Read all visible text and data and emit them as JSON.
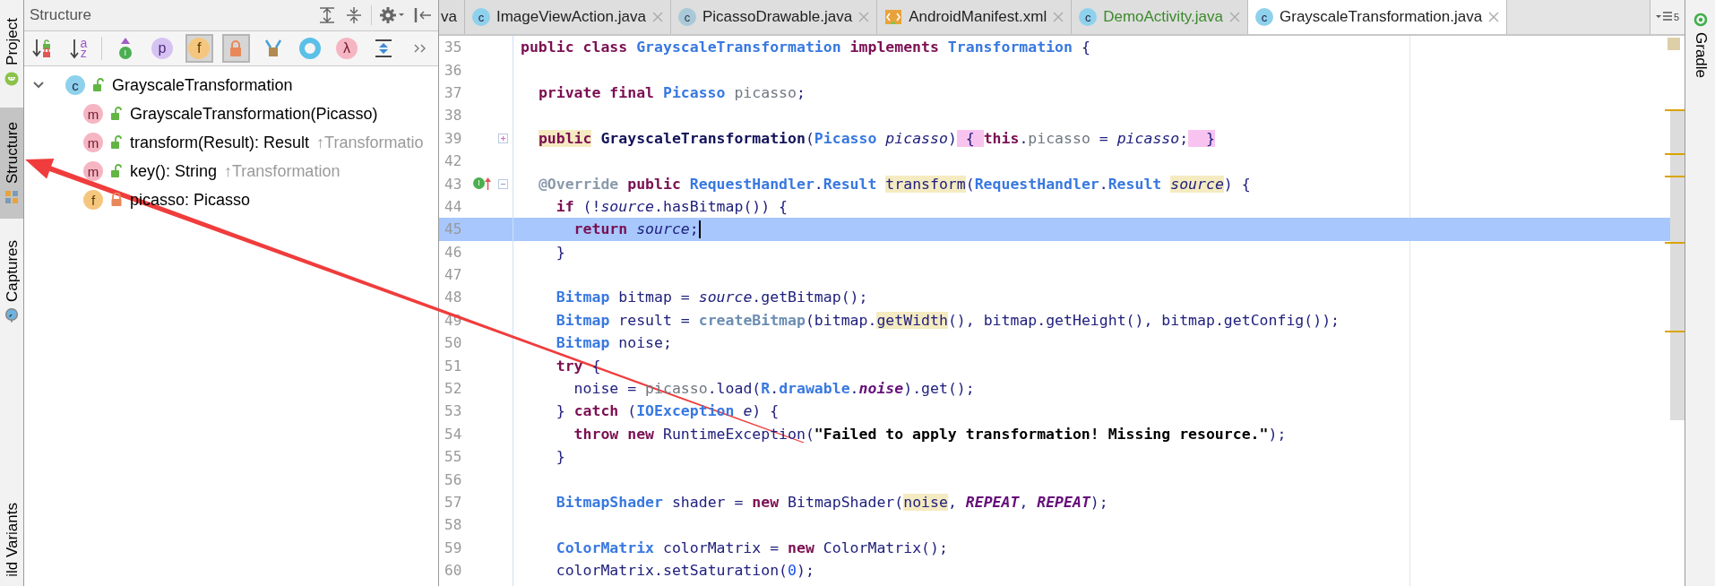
{
  "left_stripe": [
    {
      "label": "Project",
      "selected": false
    },
    {
      "label": "Structure",
      "selected": true
    },
    {
      "label": "Captures",
      "selected": false
    },
    {
      "label": "ild Variants",
      "selected": false
    }
  ],
  "structure_panel": {
    "title": "Structure",
    "toolbar": [
      {
        "kind": "sort-visibility",
        "selected": false
      },
      {
        "kind": "sort-alpha",
        "glyph": "az",
        "selected": false
      },
      {
        "kind": "inherited",
        "glyph": "I",
        "selected": false
      },
      {
        "kind": "properties",
        "glyph": "p",
        "selected": false
      },
      {
        "kind": "fields",
        "glyph": "f",
        "selected": true
      },
      {
        "kind": "non-public",
        "selected": true
      },
      {
        "kind": "anonymous",
        "selected": false
      },
      {
        "kind": "ring",
        "selected": false
      },
      {
        "kind": "lambdas",
        "glyph": "λ",
        "selected": false
      },
      {
        "kind": "autoscroll",
        "selected": false
      },
      {
        "kind": "more",
        "selected": false
      }
    ],
    "tree": {
      "kind": "class",
      "badge": "c",
      "private": false,
      "label": "GrayscaleTransformation",
      "expanded": true,
      "children": [
        {
          "kind": "method",
          "badge": "m",
          "private": false,
          "label": "GrayscaleTransformation(Picasso)"
        },
        {
          "kind": "method",
          "badge": "m",
          "private": false,
          "label": "transform(Result): Result",
          "inherited": "↑Transformatio"
        },
        {
          "kind": "method",
          "badge": "m",
          "private": false,
          "label": "key(): String",
          "inherited": "↑Transformation"
        },
        {
          "kind": "field",
          "badge": "f",
          "private": true,
          "label": "picasso: Picasso"
        }
      ]
    }
  },
  "editor": {
    "tabs": [
      {
        "kind": "partial",
        "label": "va",
        "selected": false,
        "added": false
      },
      {
        "kind": "class",
        "label": "ImageViewAction.java",
        "badge": "c",
        "selected": false,
        "added": false
      },
      {
        "kind": "drawable",
        "label": "PicassoDrawable.java",
        "badge": "c",
        "selected": false,
        "added": false
      },
      {
        "kind": "manifest",
        "label": "AndroidManifest.xml",
        "selected": false,
        "added": false
      },
      {
        "kind": "class",
        "label": "DemoActivity.java",
        "badge": "c",
        "selected": false,
        "added": true
      },
      {
        "kind": "class",
        "label": "GrayscaleTransformation.java",
        "badge": "c",
        "selected": true,
        "added": false
      }
    ],
    "hidden_tabs_count": "5",
    "lines": [
      {
        "number": "35",
        "current": false,
        "tokens": [
          {
            "kind": "kw",
            "text": "public class "
          },
          {
            "kind": "type",
            "text": "GrayscaleTransformation"
          },
          {
            "kind": "kw",
            "text": " implements "
          },
          {
            "kind": "type",
            "text": "Transformation"
          },
          {
            "kind": "plain",
            "text": " {"
          }
        ]
      },
      {
        "number": "36",
        "current": false
      },
      {
        "number": "37",
        "current": false,
        "tokens": [
          {
            "kind": "kw",
            "text": "  private final "
          },
          {
            "kind": "type",
            "text": "Picasso"
          },
          {
            "kind": "field",
            "text": " picasso"
          },
          {
            "kind": "plain",
            "text": ";"
          }
        ]
      },
      {
        "number": "38",
        "current": false
      },
      {
        "number": "39",
        "current": false,
        "folded": true,
        "tokens": [
          {
            "kind": "kw",
            "text": "  public",
            "usage_highlight": true
          },
          {
            "kind": "decl",
            "text": " GrayscaleTransformation"
          },
          {
            "kind": "plain",
            "text": "("
          },
          {
            "kind": "type",
            "text": "Picasso"
          },
          {
            "kind": "param",
            "text": " picasso"
          },
          {
            "kind": "plain",
            "text": ")"
          },
          {
            "kind": "plain",
            "text": " { ",
            "brace_highlight": true
          },
          {
            "kind": "kw",
            "text": "this"
          },
          {
            "kind": "plain",
            "text": "."
          },
          {
            "kind": "field",
            "text": "picasso"
          },
          {
            "kind": "plain",
            "text": " = "
          },
          {
            "kind": "param",
            "text": "picasso"
          },
          {
            "kind": "plain",
            "text": ";"
          },
          {
            "kind": "plain",
            "text": "  }",
            "brace_highlight": true
          }
        ]
      },
      {
        "number": "42",
        "current": false
      },
      {
        "number": "43",
        "current": false,
        "folded": false,
        "implements": true,
        "gutter_glyph": "I",
        "tokens": [
          {
            "kind": "annotation",
            "text": "  @Override"
          },
          {
            "kind": "kw",
            "text": " public "
          },
          {
            "kind": "type",
            "text": "RequestHandler"
          },
          {
            "kind": "plain",
            "text": "."
          },
          {
            "kind": "type",
            "text": "Result"
          },
          {
            "kind": "plain",
            "text": " transform",
            "usage_highlight": true
          },
          {
            "kind": "plain",
            "text": "("
          },
          {
            "kind": "type",
            "text": "RequestHandler"
          },
          {
            "kind": "plain",
            "text": "."
          },
          {
            "kind": "type",
            "text": "Result"
          },
          {
            "kind": "param",
            "text": " source",
            "usage_highlight": true
          },
          {
            "kind": "plain",
            "text": ") {"
          }
        ]
      },
      {
        "number": "44",
        "current": false,
        "tokens": [
          {
            "kind": "kw",
            "text": "    if"
          },
          {
            "kind": "plain",
            "text": " (!"
          },
          {
            "kind": "param",
            "text": "source"
          },
          {
            "kind": "plain",
            "text": ".hasBitmap()) {"
          }
        ]
      },
      {
        "number": "45",
        "current": true,
        "tokens": [
          {
            "kind": "kw",
            "text": "      return"
          },
          {
            "kind": "param",
            "text": " source"
          },
          {
            "kind": "plain",
            "text": ";"
          }
        ]
      },
      {
        "number": "46",
        "current": false,
        "tokens": [
          {
            "kind": "plain",
            "text": "    }"
          }
        ]
      },
      {
        "number": "47",
        "current": false
      },
      {
        "number": "48",
        "current": false,
        "tokens": [
          {
            "kind": "type",
            "text": "    Bitmap"
          },
          {
            "kind": "plain",
            "text": " bitmap = "
          },
          {
            "kind": "param",
            "text": "source"
          },
          {
            "kind": "plain",
            "text": ".getBitmap();"
          }
        ]
      },
      {
        "number": "49",
        "current": false,
        "tokens": [
          {
            "kind": "type",
            "text": "    Bitmap"
          },
          {
            "kind": "plain",
            "text": " result = "
          },
          {
            "kind": "method",
            "text": "createBitmap"
          },
          {
            "kind": "plain",
            "text": "(bitmap."
          },
          {
            "kind": "plain",
            "text": "getWidth",
            "usage_highlight": true
          },
          {
            "kind": "plain",
            "text": "(), bitmap.getHeight(), bitmap.getConfig());"
          }
        ]
      },
      {
        "number": "50",
        "current": false,
        "tokens": [
          {
            "kind": "type",
            "text": "    Bitmap"
          },
          {
            "kind": "plain",
            "text": " noise;"
          }
        ]
      },
      {
        "number": "51",
        "current": false,
        "tokens": [
          {
            "kind": "kw",
            "text": "    try"
          },
          {
            "kind": "plain",
            "text": " {"
          }
        ]
      },
      {
        "number": "52",
        "current": false,
        "tokens": [
          {
            "kind": "plain",
            "text": "      noise = "
          },
          {
            "kind": "field",
            "text": "picasso"
          },
          {
            "kind": "plain",
            "text": ".load("
          },
          {
            "kind": "type",
            "text": "R"
          },
          {
            "kind": "plain",
            "text": "."
          },
          {
            "kind": "type",
            "text": "drawable"
          },
          {
            "kind": "plain",
            "text": "."
          },
          {
            "kind": "static",
            "text": "noise"
          },
          {
            "kind": "plain",
            "text": ").get();"
          }
        ]
      },
      {
        "number": "53",
        "current": false,
        "tokens": [
          {
            "kind": "plain",
            "text": "    } "
          },
          {
            "kind": "kw",
            "text": "catch"
          },
          {
            "kind": "plain",
            "text": " ("
          },
          {
            "kind": "type",
            "text": "IOException"
          },
          {
            "kind": "param",
            "text": " e"
          },
          {
            "kind": "plain",
            "text": ") {"
          }
        ]
      },
      {
        "number": "54",
        "current": false,
        "tokens": [
          {
            "kind": "kw",
            "text": "      throw new"
          },
          {
            "kind": "plain",
            "text": " RuntimeException("
          },
          {
            "kind": "string",
            "text": "\"Failed to apply transformation! Missing resource.\""
          },
          {
            "kind": "plain",
            "text": ");"
          }
        ]
      },
      {
        "number": "55",
        "current": false,
        "tokens": [
          {
            "kind": "plain",
            "text": "    }"
          }
        ]
      },
      {
        "number": "56",
        "current": false
      },
      {
        "number": "57",
        "current": false,
        "tokens": [
          {
            "kind": "type",
            "text": "    BitmapShader"
          },
          {
            "kind": "plain",
            "text": " shader = "
          },
          {
            "kind": "kw",
            "text": "new"
          },
          {
            "kind": "plain",
            "text": " BitmapShader("
          },
          {
            "kind": "plain",
            "text": "noise",
            "usage_highlight": true
          },
          {
            "kind": "plain",
            "text": ", "
          },
          {
            "kind": "static",
            "text": "REPEAT"
          },
          {
            "kind": "plain",
            "text": ", "
          },
          {
            "kind": "static",
            "text": "REPEAT"
          },
          {
            "kind": "plain",
            "text": ");"
          }
        ]
      },
      {
        "number": "58",
        "current": false
      },
      {
        "number": "59",
        "current": false,
        "tokens": [
          {
            "kind": "type",
            "text": "    ColorMatrix"
          },
          {
            "kind": "plain",
            "text": " colorMatrix = "
          },
          {
            "kind": "kw",
            "text": "new"
          },
          {
            "kind": "plain",
            "text": " ColorMatrix();"
          }
        ]
      },
      {
        "number": "60",
        "current": false,
        "tokens": [
          {
            "kind": "plain",
            "text": "    colorMatrix.setSaturation("
          },
          {
            "kind": "number",
            "text": "0"
          },
          {
            "kind": "plain",
            "text": ");"
          }
        ]
      }
    ]
  },
  "right_stripe": [
    {
      "label": "Gradle",
      "selected": false
    }
  ]
}
